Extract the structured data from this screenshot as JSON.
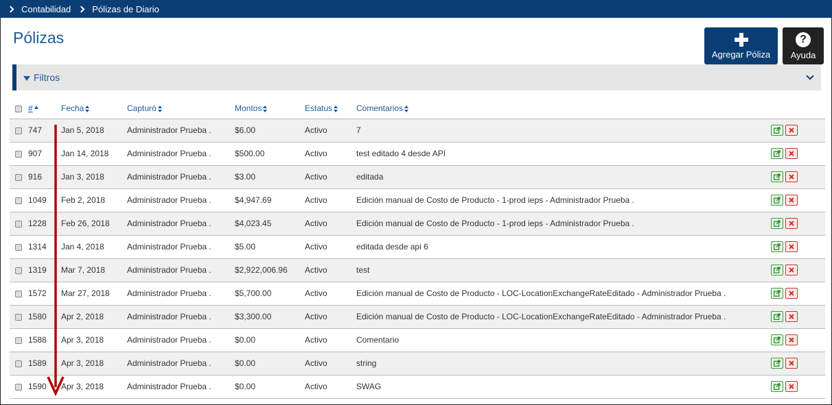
{
  "breadcrumb": [
    "Contabilidad",
    "Pólizas de Diario"
  ],
  "page_title": "Pólizas",
  "buttons": {
    "add": "Agregar Póliza",
    "help": "Ayuda"
  },
  "filters_label": "Filtros",
  "columns": [
    "#",
    "Fecha",
    "Capturó",
    "Montos",
    "Estatus",
    "Comentarios"
  ],
  "rows": [
    {
      "num": "747",
      "fecha": "Jan 5, 2018",
      "capturo": "Administrador Prueba .",
      "monto": "$6.00",
      "estatus": "Activo",
      "comentario": "7"
    },
    {
      "num": "907",
      "fecha": "Jan 14, 2018",
      "capturo": "Administrador Prueba .",
      "monto": "$500.00",
      "estatus": "Activo",
      "comentario": "test editado 4 desde API"
    },
    {
      "num": "916",
      "fecha": "Jan 3, 2018",
      "capturo": "Administrador Prueba .",
      "monto": "$3.00",
      "estatus": "Activo",
      "comentario": "editada"
    },
    {
      "num": "1049",
      "fecha": "Feb 2, 2018",
      "capturo": "Administrador Prueba .",
      "monto": "$4,947.69",
      "estatus": "Activo",
      "comentario": "Edición manual de Costo de Producto - 1-prod ieps - Administrador Prueba ."
    },
    {
      "num": "1228",
      "fecha": "Feb 26, 2018",
      "capturo": "Administrador Prueba .",
      "monto": "$4,023.45",
      "estatus": "Activo",
      "comentario": "Edición manual de Costo de Producto - 1-prod ieps - Administrador Prueba ."
    },
    {
      "num": "1314",
      "fecha": "Jan 4, 2018",
      "capturo": "Administrador Prueba .",
      "monto": "$5.00",
      "estatus": "Activo",
      "comentario": "editada desde api 6"
    },
    {
      "num": "1319",
      "fecha": "Mar 7, 2018",
      "capturo": "Administrador Prueba .",
      "monto": "$2,922,006.96",
      "estatus": "Activo",
      "comentario": "test"
    },
    {
      "num": "1572",
      "fecha": "Mar 27, 2018",
      "capturo": "Administrador Prueba .",
      "monto": "$5,700.00",
      "estatus": "Activo",
      "comentario": "Edición manual de Costo de Producto - LOC-LocationExchangeRateEditado - Administrador Prueba ."
    },
    {
      "num": "1580",
      "fecha": "Apr 2, 2018",
      "capturo": "Administrador Prueba .",
      "monto": "$3,300.00",
      "estatus": "Activo",
      "comentario": "Edición manual de Costo de Producto - LOC-LocationExchangeRateEditado - Administrador Prueba ."
    },
    {
      "num": "1588",
      "fecha": "Apr 3, 2018",
      "capturo": "Administrador Prueba .",
      "monto": "$0.00",
      "estatus": "Activo",
      "comentario": "Comentario"
    },
    {
      "num": "1589",
      "fecha": "Apr 3, 2018",
      "capturo": "Administrador Prueba .",
      "monto": "$0.00",
      "estatus": "Activo",
      "comentario": "string"
    },
    {
      "num": "1590",
      "fecha": "Apr 3, 2018",
      "capturo": "Administrador Prueba .",
      "monto": "$0.00",
      "estatus": "Activo",
      "comentario": "SWAG"
    }
  ],
  "row_actions": [
    "external-link-icon",
    "delete-x-icon"
  ],
  "colors": {
    "header_bar": "#0b3e75",
    "accent_text": "#1a5c9a",
    "annotation_arrow": "#b00000"
  }
}
